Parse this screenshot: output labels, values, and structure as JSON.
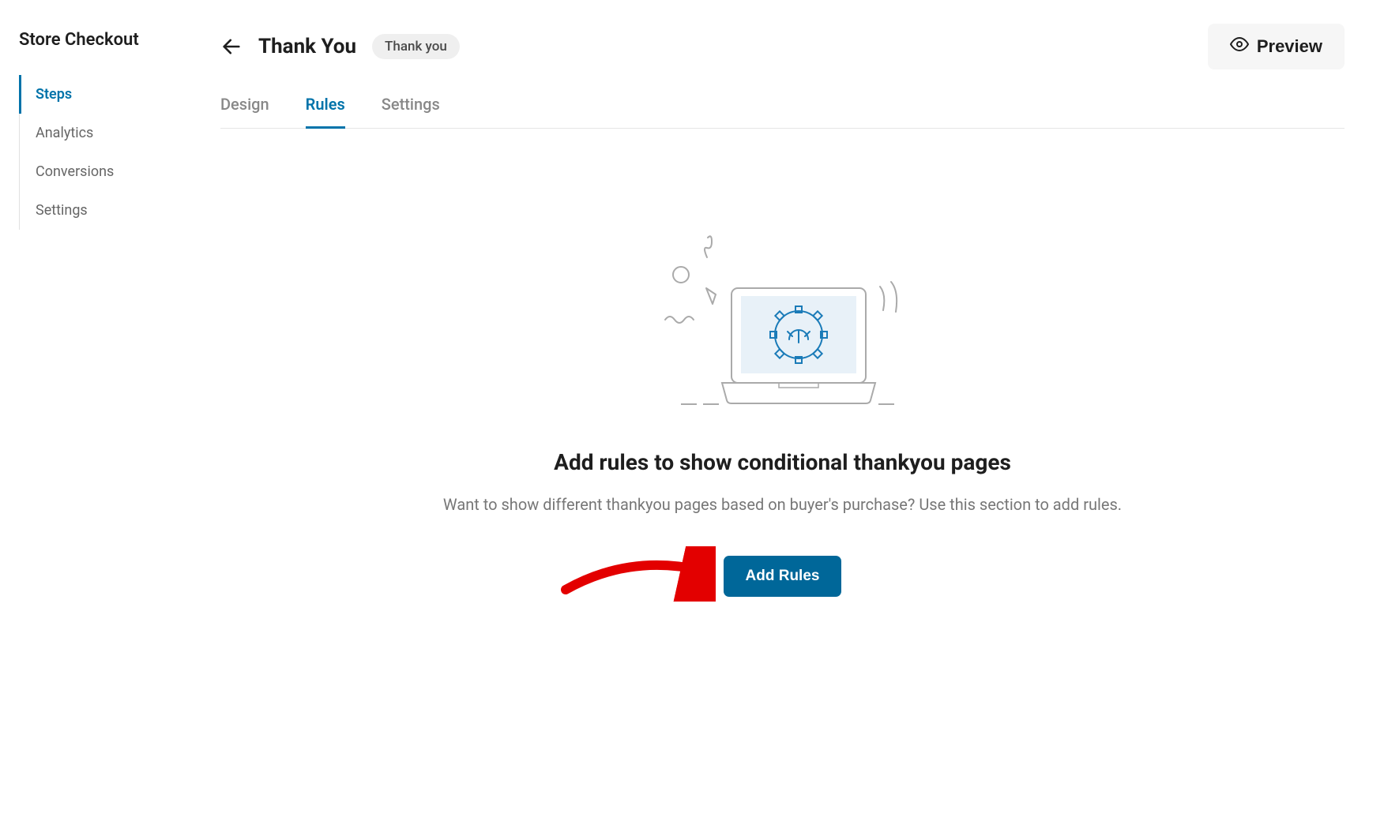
{
  "sidebar": {
    "title": "Store Checkout",
    "items": [
      {
        "label": "Steps",
        "active": true
      },
      {
        "label": "Analytics",
        "active": false
      },
      {
        "label": "Conversions",
        "active": false
      },
      {
        "label": "Settings",
        "active": false
      }
    ]
  },
  "header": {
    "title": "Thank You",
    "badge": "Thank you",
    "preview_label": "Preview"
  },
  "tabs": [
    {
      "label": "Design",
      "active": false
    },
    {
      "label": "Rules",
      "active": true
    },
    {
      "label": "Settings",
      "active": false
    }
  ],
  "empty_state": {
    "title": "Add rules to show conditional thankyou pages",
    "description": "Want to show different thankyou pages based on buyer's purchase? Use this section to add rules.",
    "button_label": "Add Rules"
  }
}
